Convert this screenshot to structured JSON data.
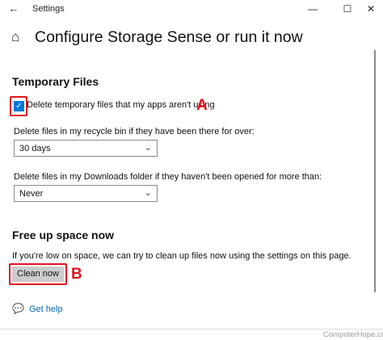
{
  "window": {
    "title": "Settings",
    "back_glyph": "←",
    "min_glyph": "—",
    "max_glyph": "☐",
    "close_glyph": "✕"
  },
  "header": {
    "home_icon": "⌂",
    "title": "Configure Storage Sense or run it now"
  },
  "temporary_files": {
    "section_title": "Temporary Files",
    "delete_temp_checkbox": {
      "label": "Delete temporary files that my apps aren't using",
      "checked": true,
      "check_glyph": "✓"
    },
    "recycle_bin": {
      "label": "Delete files in my recycle bin if they have been there for over:",
      "selected": "30 days"
    },
    "downloads": {
      "label": "Delete files in my Downloads folder if they haven't been opened for more than:",
      "selected": "Never"
    },
    "chevron_glyph": "⌄"
  },
  "free_up_space": {
    "section_title": "Free up space now",
    "description": "If you're low on space, we can try to clean up files now using the settings on this page.",
    "clean_now_label": "Clean now"
  },
  "help": {
    "icon": "💬",
    "link_label": "Get help"
  },
  "annotations": {
    "marker_a": "A",
    "marker_b": "B",
    "highlight_color": "#e0141e"
  },
  "watermark": "ComputerHope.com",
  "colors": {
    "accent": "#0078d7",
    "link": "#0067b8",
    "button_bg": "#cccccc"
  }
}
